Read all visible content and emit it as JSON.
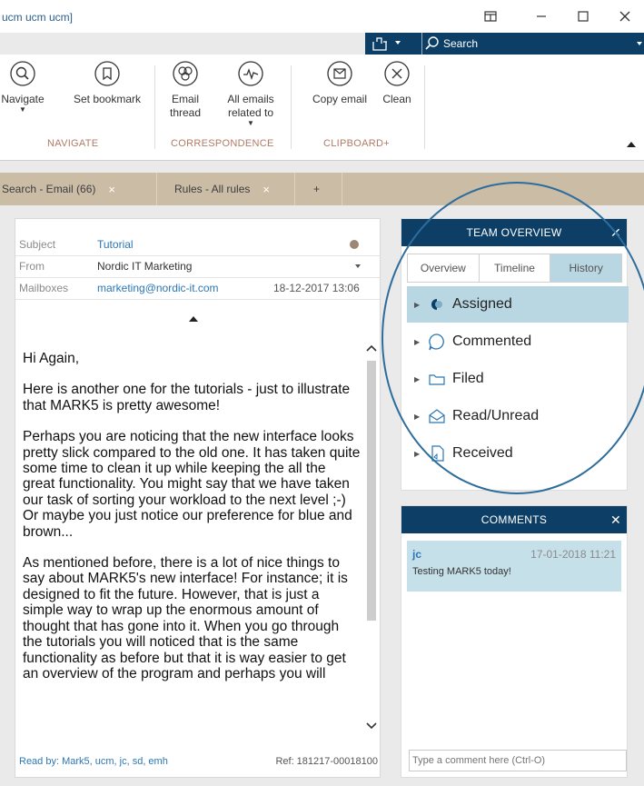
{
  "window": {
    "title": "ucm ucm ucm]"
  },
  "search": {
    "label": "Search"
  },
  "ribbon": {
    "buttons": [
      {
        "label": "Navigate"
      },
      {
        "label": "Set bookmark"
      },
      {
        "label": "Email thread"
      },
      {
        "label": "All emails related to"
      },
      {
        "label": "Copy email"
      },
      {
        "label": "Clean"
      }
    ],
    "groups": [
      "NAVIGATE",
      "CORRESPONDENCE",
      "CLIPBOARD+"
    ]
  },
  "tabs": [
    {
      "label": "Search - Email (66)",
      "close": "×"
    },
    {
      "label": "Rules - All rules",
      "close": "×"
    },
    {
      "label": "+"
    }
  ],
  "email": {
    "subject_label": "Subject",
    "subject": "Tutorial",
    "from_label": "From",
    "from": "Nordic IT Marketing",
    "mailboxes_label": "Mailboxes",
    "mailbox": "marketing@nordic-it.com",
    "date": "18-12-2017 13:06",
    "paragraphs": [
      "Hi Again,",
      "Here is another one for the tutorials - just to illustrate that MARK5 is pretty awesome!",
      "Perhaps you are noticing that the new interface looks pretty slick compared to the old one. It has taken quite some time to clean it up while keeping the all the great functionality. You might say that we have taken our task of sorting your workload to the next level ;-) Or maybe you just notice our preference for blue and brown...",
      "As mentioned before, there is a lot of nice things to say about MARK5's new interface! For instance; it is designed to fit the future. However, that is just a simple way to wrap up the enormous amount of thought that has gone into it. When you go through the tutorials you will noticed that is the same functionality as before but that it is way easier to get an overview of the program and perhaps you will"
    ],
    "read_by": "Read by:  Mark5, ucm, jc, sd, emh",
    "ref": "Ref: 181217-00018100"
  },
  "team_overview": {
    "title": "TEAM OVERVIEW",
    "tabs": [
      "Overview",
      "Timeline",
      "History"
    ],
    "items": [
      "Assigned",
      "Commented",
      "Filed",
      "Read/Unread",
      "Received"
    ]
  },
  "comments": {
    "title": "COMMENTS",
    "author": "jc",
    "time": "17-01-2018 11:21",
    "text": "Testing MARK5 today!",
    "placeholder": "Type a comment here (Ctrl-O)"
  },
  "colors": {
    "navy": "#0d3f66",
    "tab_bar": "#cbbca6",
    "highlight": "#b9d7e3",
    "link": "#2b77b5"
  }
}
